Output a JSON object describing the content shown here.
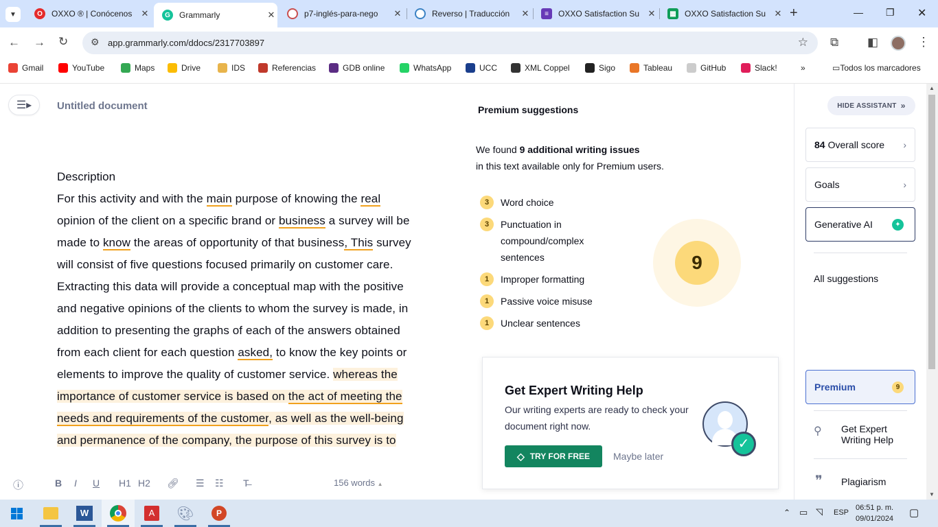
{
  "browser": {
    "tabs": [
      {
        "title": "OXXO ® | Conócenos",
        "icon_color": "#e52b2b",
        "icon_name": "oxxo-favicon"
      },
      {
        "title": "Grammarly",
        "icon_color": "#15c39a",
        "icon_name": "grammarly-favicon"
      },
      {
        "title": "p7-inglés-para-nego",
        "icon_color": "#c94f4f",
        "icon_name": "document-favicon"
      },
      {
        "title": "Reverso | Traducción",
        "icon_color": "#3b82c4",
        "icon_name": "reverso-favicon"
      },
      {
        "title": "OXXO Satisfaction Su",
        "icon_color": "#673ab7",
        "icon_name": "google-forms-favicon"
      },
      {
        "title": "OXXO Satisfaction Su",
        "icon_color": "#0f9d58",
        "icon_name": "google-sheets-favicon"
      }
    ],
    "url": "app.grammarly.com/ddocs/2317703897",
    "bookmarks": [
      {
        "label": "Gmail",
        "color": "#ea4335"
      },
      {
        "label": "YouTube",
        "color": "#ff0000"
      },
      {
        "label": "Maps",
        "color": "#34a853"
      },
      {
        "label": "Drive",
        "color": "#fbbc04"
      },
      {
        "label": "IDS",
        "color": "#e8b44b"
      },
      {
        "label": "Referencias",
        "color": "#c0392b"
      },
      {
        "label": "GDB online",
        "color": "#5b2c83"
      },
      {
        "label": "WhatsApp",
        "color": "#25d366"
      },
      {
        "label": "UCC",
        "color": "#1a3e8c"
      },
      {
        "label": "XML Coppel",
        "color": "#333333"
      },
      {
        "label": "Sigo",
        "color": "#222222"
      },
      {
        "label": "Tableau",
        "color": "#e97627"
      },
      {
        "label": "GitHub",
        "color": "#cccccc"
      },
      {
        "label": "Slack!",
        "color": "#e01e5a"
      }
    ],
    "all_bookmarks": "Todos los marcadores"
  },
  "editor": {
    "doc_title": "Untitled document",
    "heading": "Description",
    "body": [
      {
        "t": "For this activity and with the "
      },
      {
        "t": "main",
        "s": "u"
      },
      {
        "t": " purpose of knowing the "
      },
      {
        "t": "real",
        "s": "u"
      },
      {
        "t": " opinion of the client on a specific brand or "
      },
      {
        "t": "business",
        "s": "u"
      },
      {
        "t": " a survey will be made to "
      },
      {
        "t": "know",
        "s": "u"
      },
      {
        "t": " the areas of opportunity of that business"
      },
      {
        "t": ", This",
        "s": "u"
      },
      {
        "t": " survey will consist of five questions focused primarily on customer care. Extracting this data will provide a conceptual map with the positive and negative opinions of the clients to whom the survey is made, in addition to presenting the graphs of each of the answers obtained from each client for each question "
      },
      {
        "t": "asked,",
        "s": "u"
      },
      {
        "t": " to know the key points or elements to improve the quality of customer service. "
      },
      {
        "t": "whereas the importance of customer service is based on ",
        "s": "hl"
      },
      {
        "t": "the act of meeting the needs and requirements of the customer",
        "s": "hlu"
      },
      {
        "t": ", as well as the well-being and permanence of the company, the purpose of this survey is to",
        "s": "hl"
      }
    ],
    "word_count": "156 words"
  },
  "premium": {
    "title": "Premium suggestions",
    "found_prefix": "We found ",
    "found_bold": "9 additional writing issues",
    "found_suffix": "in this text available only for Premium users.",
    "issues": [
      {
        "count": "3",
        "label": "Word choice"
      },
      {
        "count": "3",
        "label": "Punctuation in compound/complex sentences"
      },
      {
        "count": "1",
        "label": "Improper formatting"
      },
      {
        "count": "1",
        "label": "Passive voice misuse"
      },
      {
        "count": "1",
        "label": "Unclear sentences"
      }
    ],
    "total": "9",
    "expert_title": "Get Expert Writing Help",
    "expert_text": "Our writing experts are ready to check your document right now.",
    "try_button": "TRY FOR FREE",
    "maybe_later": "Maybe later"
  },
  "sidebar": {
    "hide_assistant": "HIDE ASSISTANT",
    "score_value": "84",
    "score_label": "Overall score",
    "goals": "Goals",
    "generative_ai": "Generative AI",
    "all_suggestions": "All suggestions",
    "premium": "Premium",
    "premium_count": "9",
    "expert_help": "Get Expert Writing Help",
    "plagiarism": "Plagiarism"
  },
  "taskbar": {
    "time": "06:51 p. m.",
    "date": "09/01/2024",
    "lang": "ESP"
  }
}
